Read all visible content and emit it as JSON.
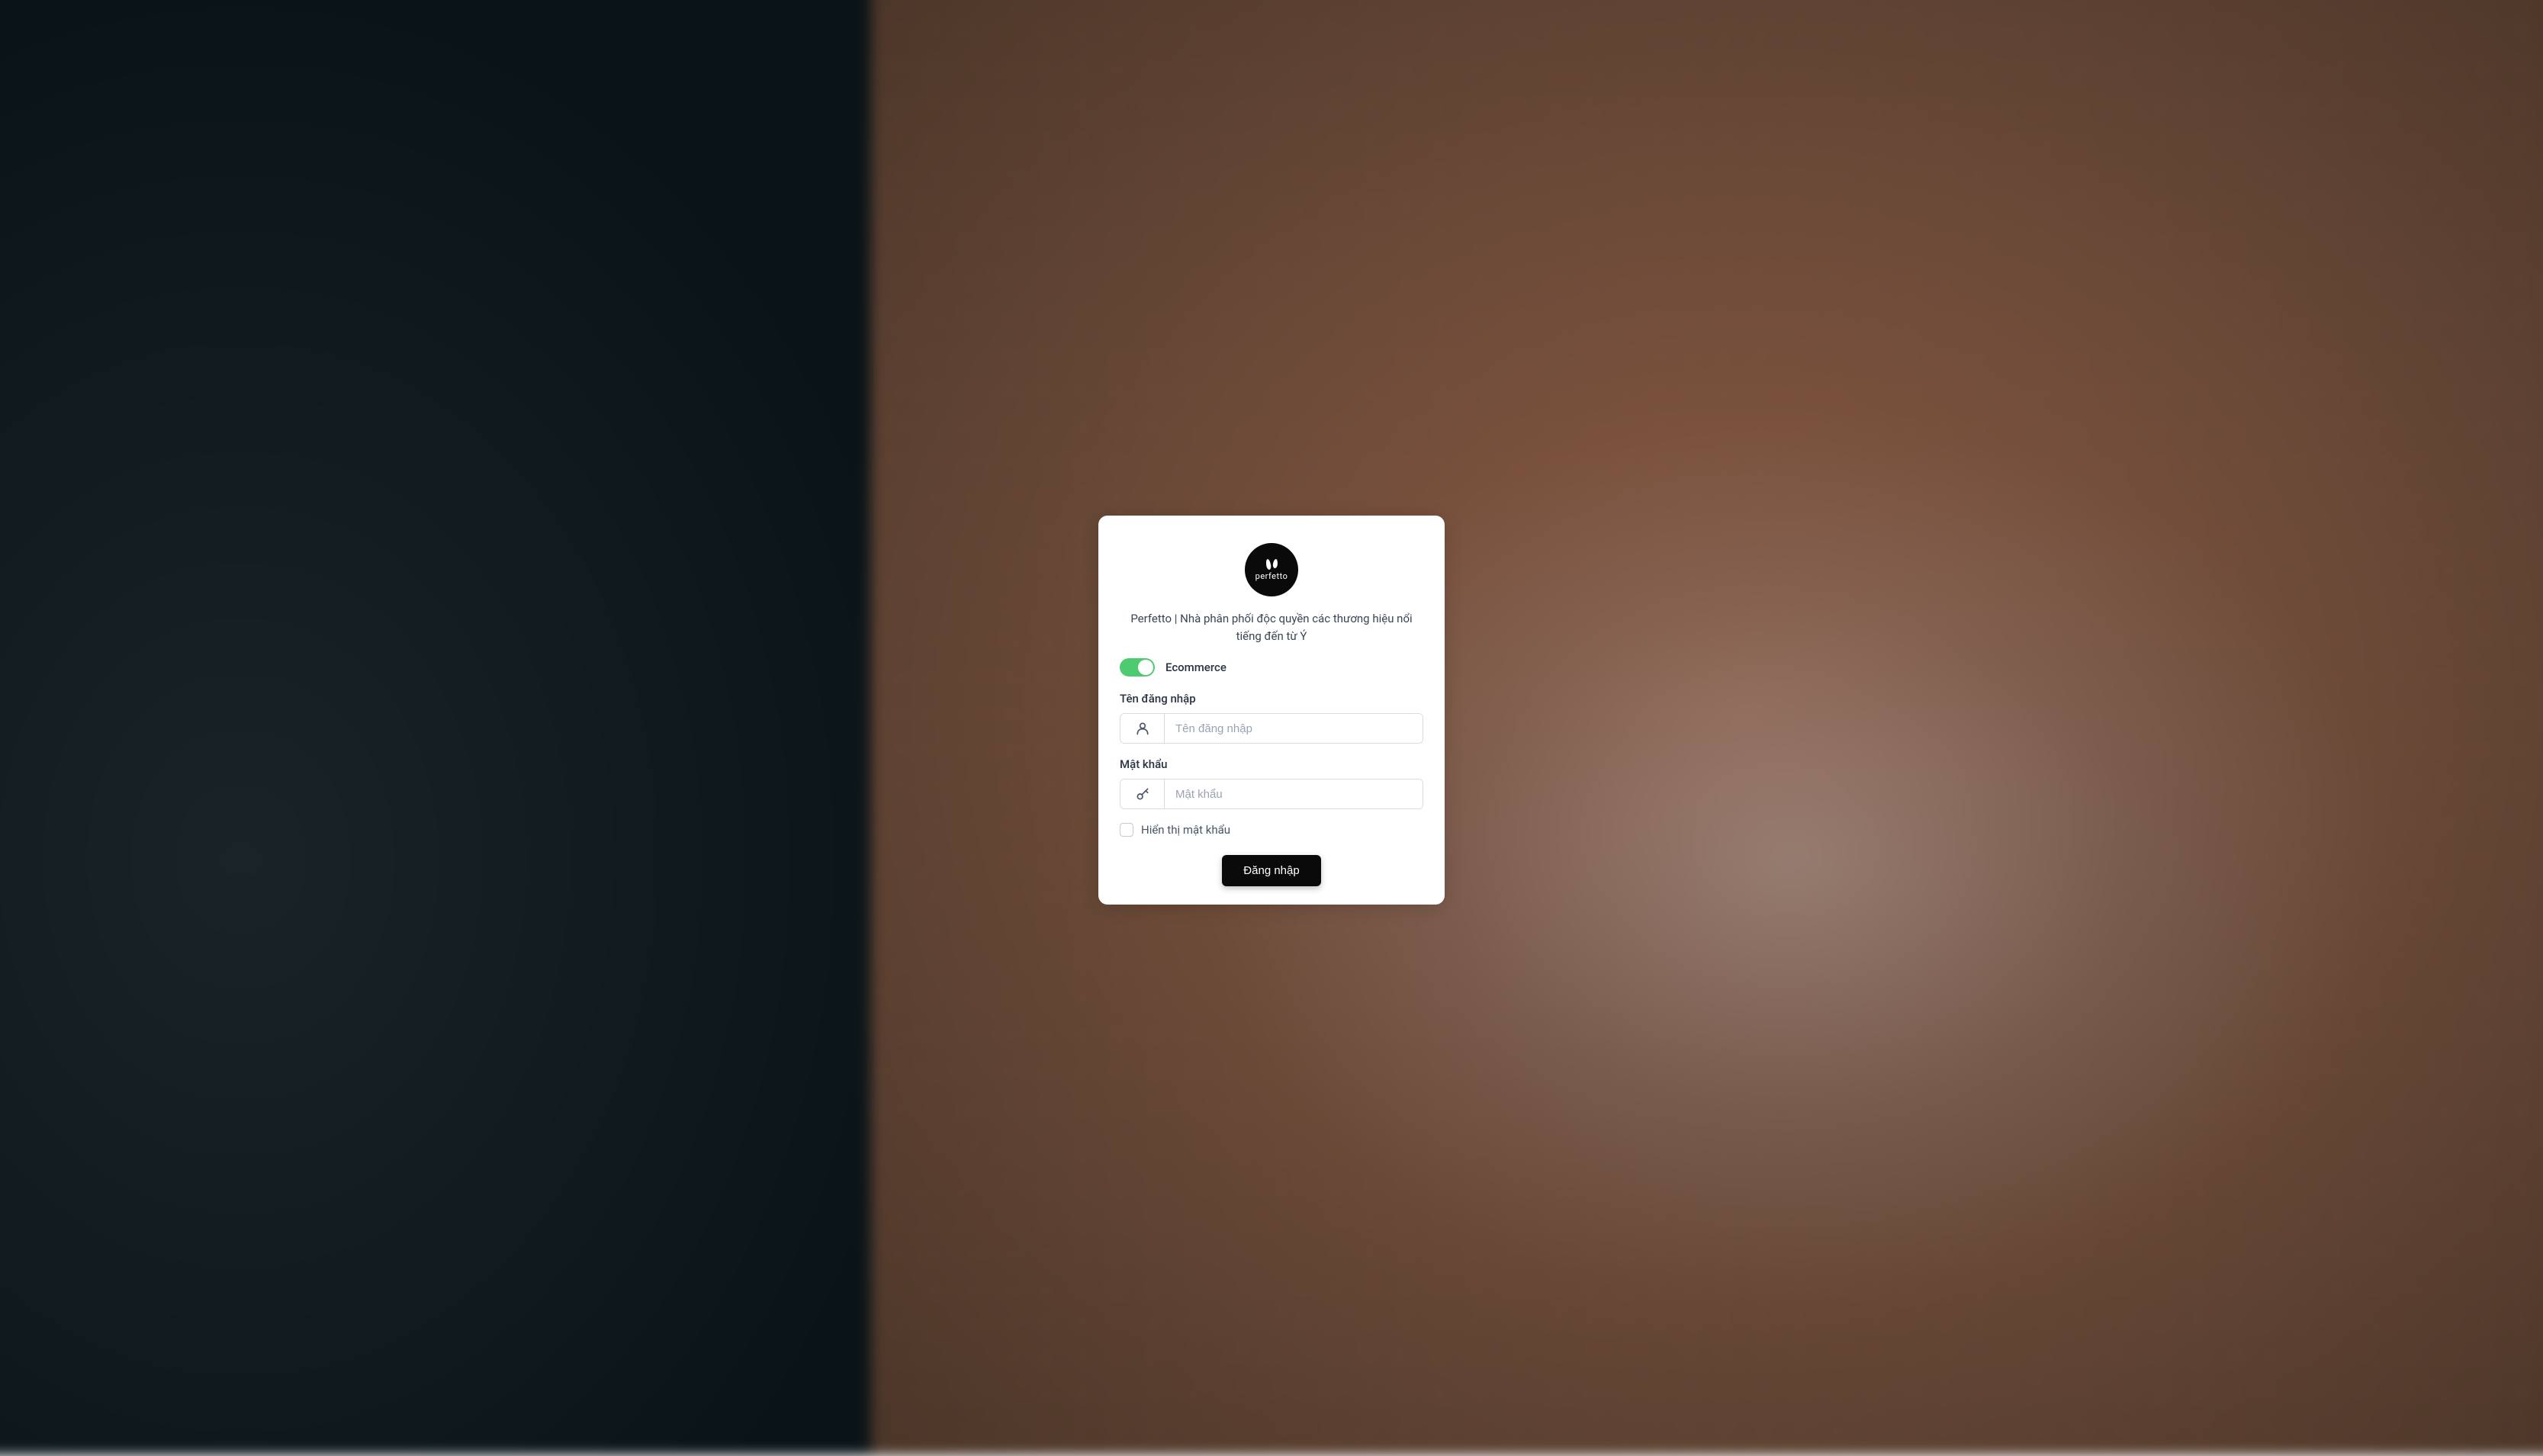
{
  "logo": {
    "brand": "perfetto"
  },
  "subtitle": "Perfetto | Nhà phân phối độc quyền các thương hiệu nổi tiếng đến từ Ý",
  "toggle": {
    "label": "Ecommerce",
    "on": true
  },
  "form": {
    "username": {
      "label": "Tên đăng nhập",
      "placeholder": "Tên đăng nhập",
      "value": ""
    },
    "password": {
      "label": "Mật khẩu",
      "placeholder": "Mật khẩu",
      "value": ""
    },
    "show_password": {
      "label": "Hiển thị mật khẩu",
      "checked": false
    },
    "submit": "Đăng nhập"
  }
}
